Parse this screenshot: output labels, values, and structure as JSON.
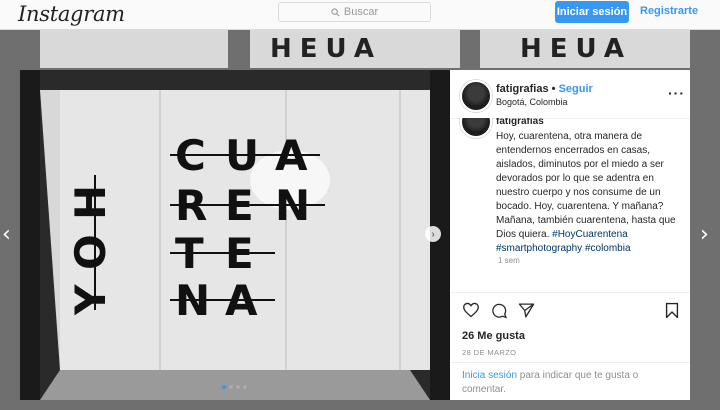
{
  "header": {
    "logo": "Instagram",
    "search_placeholder": "Buscar",
    "login_button": "Iniciar sesión",
    "register_link": "Registrarte"
  },
  "post": {
    "username": "fatigrafias",
    "follow_separator": "•",
    "follow_label": "Seguir",
    "location": "Bogotá, Colombia",
    "more_icon": "more-icon",
    "caption_user": "fatigrafias",
    "caption": "Hoy, cuarentena, otra manera de entendernos encerrados en casas, aislados, diminutos por el miedo a ser devorados por lo que se adentra en nuestro cuerpo y nos consume de un bocado. Hoy, cuarentena. Y mañana? Mañana, también cuarentena, hasta que Dios quiera.",
    "hashtags": "#HoyCuarentena #smartphotography #colombia",
    "time_ago": "1 sem",
    "likes": "26 Me gusta",
    "date": "28 DE MARZO",
    "login_link": "Inicia sesión",
    "login_text": " para indicar que te gusta o comentar."
  },
  "photo": {
    "word_left": [
      "H",
      "O",
      "Y"
    ],
    "row1": [
      "C",
      "U",
      "A"
    ],
    "row2": [
      "R",
      "E",
      "N"
    ],
    "row3": [
      "T",
      "E"
    ],
    "row4": [
      "N",
      "A"
    ]
  },
  "background": {
    "thumb_text": "HEUA"
  },
  "carousel": {
    "total": 4,
    "active": 1
  },
  "colors": {
    "accent": "#3897f0",
    "hashtag": "#003569"
  }
}
